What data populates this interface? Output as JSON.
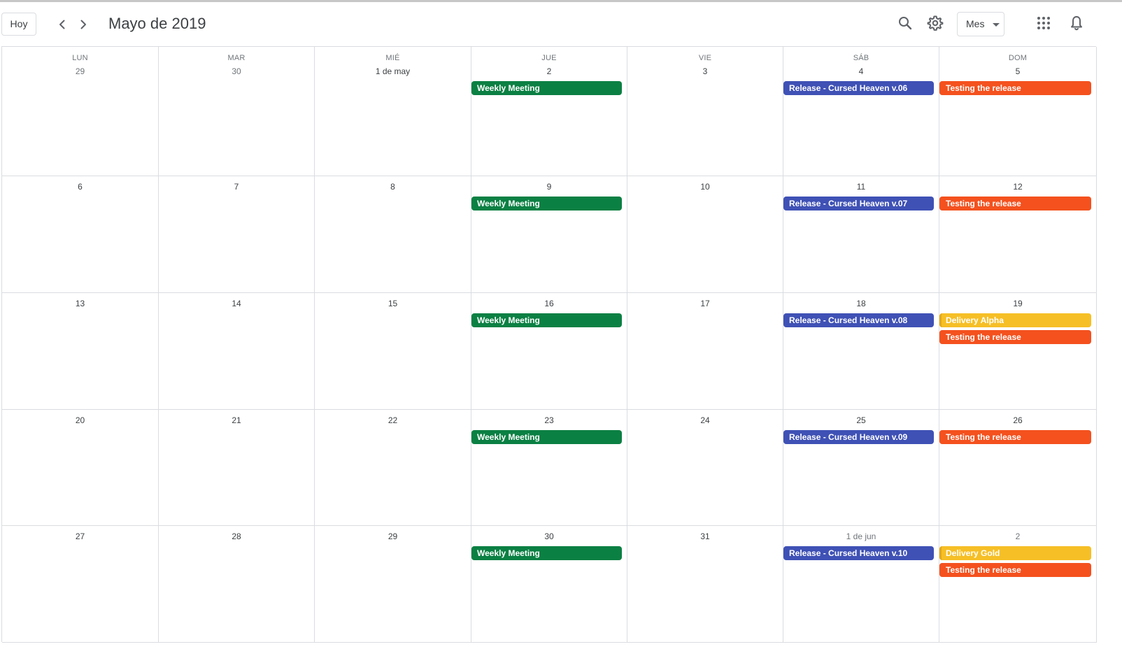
{
  "header": {
    "today_label": "Hoy",
    "month_title": "Mayo de 2019",
    "view_label": "Mes",
    "icons": [
      "chevron-left-icon",
      "chevron-right-icon",
      "search-icon",
      "gear-icon",
      "apps-grid-icon",
      "bell-icon"
    ]
  },
  "weekdays": [
    "LUN",
    "MAR",
    "MIÉ",
    "JUE",
    "VIE",
    "SÁB",
    "DOM"
  ],
  "colors": {
    "weekly_meeting": "#0b8043",
    "release": "#3f51b5",
    "testing": "#f4511e",
    "delivery": "#f6bf26"
  },
  "weeks": [
    {
      "days": [
        {
          "label": "29",
          "muted": true,
          "events": []
        },
        {
          "label": "30",
          "muted": true,
          "events": []
        },
        {
          "label": "1 de may",
          "muted": false,
          "events": []
        },
        {
          "label": "2",
          "muted": false,
          "events": [
            {
              "title": "Weekly Meeting",
              "color": "green"
            }
          ]
        },
        {
          "label": "3",
          "muted": false,
          "events": []
        },
        {
          "label": "4",
          "muted": false,
          "events": [
            {
              "title": "Release - Cursed Heaven v.06",
              "color": "blue"
            }
          ]
        },
        {
          "label": "5",
          "muted": false,
          "events": [
            {
              "title": "Testing the release",
              "color": "orange"
            }
          ]
        }
      ]
    },
    {
      "days": [
        {
          "label": "6",
          "muted": false,
          "events": []
        },
        {
          "label": "7",
          "muted": false,
          "events": []
        },
        {
          "label": "8",
          "muted": false,
          "events": []
        },
        {
          "label": "9",
          "muted": false,
          "events": [
            {
              "title": "Weekly Meeting",
              "color": "green"
            }
          ]
        },
        {
          "label": "10",
          "muted": false,
          "events": []
        },
        {
          "label": "11",
          "muted": false,
          "events": [
            {
              "title": "Release - Cursed Heaven v.07",
              "color": "blue"
            }
          ]
        },
        {
          "label": "12",
          "muted": false,
          "events": [
            {
              "title": "Testing the release",
              "color": "orange"
            }
          ]
        }
      ]
    },
    {
      "days": [
        {
          "label": "13",
          "muted": false,
          "events": []
        },
        {
          "label": "14",
          "muted": false,
          "events": []
        },
        {
          "label": "15",
          "muted": false,
          "events": []
        },
        {
          "label": "16",
          "muted": false,
          "events": [
            {
              "title": "Weekly Meeting",
              "color": "green"
            }
          ]
        },
        {
          "label": "17",
          "muted": false,
          "events": []
        },
        {
          "label": "18",
          "muted": false,
          "events": [
            {
              "title": "Release - Cursed Heaven v.08",
              "color": "blue"
            }
          ]
        },
        {
          "label": "19",
          "muted": false,
          "events": [
            {
              "title": "Delivery Alpha",
              "color": "yellow"
            },
            {
              "title": "Testing the release",
              "color": "orange"
            }
          ]
        }
      ]
    },
    {
      "days": [
        {
          "label": "20",
          "muted": false,
          "events": []
        },
        {
          "label": "21",
          "muted": false,
          "events": []
        },
        {
          "label": "22",
          "muted": false,
          "events": []
        },
        {
          "label": "23",
          "muted": false,
          "events": [
            {
              "title": "Weekly Meeting",
              "color": "green"
            }
          ]
        },
        {
          "label": "24",
          "muted": false,
          "events": []
        },
        {
          "label": "25",
          "muted": false,
          "events": [
            {
              "title": "Release - Cursed Heaven v.09",
              "color": "blue"
            }
          ]
        },
        {
          "label": "26",
          "muted": false,
          "events": [
            {
              "title": "Testing the release",
              "color": "orange"
            }
          ]
        }
      ]
    },
    {
      "days": [
        {
          "label": "27",
          "muted": false,
          "events": []
        },
        {
          "label": "28",
          "muted": false,
          "events": []
        },
        {
          "label": "29",
          "muted": false,
          "events": []
        },
        {
          "label": "30",
          "muted": false,
          "events": [
            {
              "title": "Weekly Meeting",
              "color": "green"
            }
          ]
        },
        {
          "label": "31",
          "muted": false,
          "events": []
        },
        {
          "label": "1 de jun",
          "muted": true,
          "events": [
            {
              "title": "Release - Cursed Heaven v.10",
              "color": "blue"
            }
          ]
        },
        {
          "label": "2",
          "muted": true,
          "events": [
            {
              "title": "Delivery Gold",
              "color": "yellow"
            },
            {
              "title": "Testing the release",
              "color": "orange"
            }
          ]
        }
      ]
    }
  ]
}
